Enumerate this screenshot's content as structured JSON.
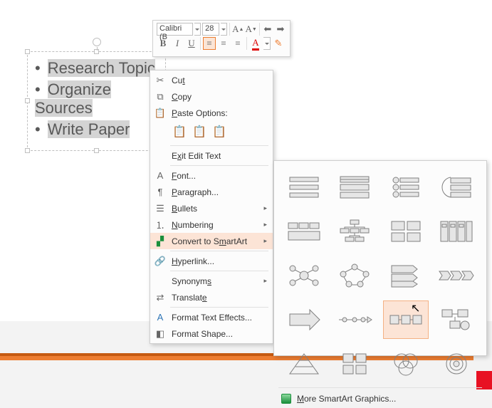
{
  "textbox": {
    "items": [
      "Research Topic",
      "Organize Sources",
      "Write Paper"
    ]
  },
  "miniToolbar": {
    "fontName": "Calibri (B",
    "fontSize": "28",
    "bold": "B",
    "italic": "I",
    "underline": "U",
    "growFont": "A▲",
    "shrinkFont": "A▼"
  },
  "contextMenu": {
    "cut": "Cut",
    "copy": "Copy",
    "pasteOptions": "Paste Options:",
    "exitEditText": "Exit Edit Text",
    "font": "Font...",
    "paragraph": "Paragraph...",
    "bullets": "Bullets",
    "numbering": "Numbering",
    "convertToSmartArt": "Convert to SmartArt",
    "hyperlink": "Hyperlink...",
    "synonyms": "Synonyms",
    "translate": "Translate",
    "formatTextEffects": "Format Text Effects...",
    "formatShape": "Format Shape..."
  },
  "smartArtPanel": {
    "more": "More SmartArt Graphics..."
  }
}
